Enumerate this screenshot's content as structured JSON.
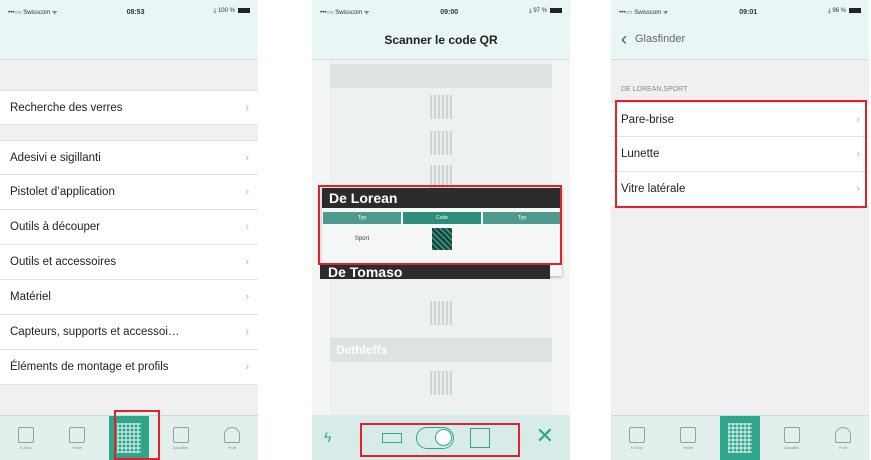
{
  "status": [
    {
      "carrier": "•••○○ Swisscom ᯤ",
      "time": "08:53",
      "right": "⤓ 100 %"
    },
    {
      "carrier": "•••○○ Swisscom ᯤ",
      "time": "09:00",
      "right": "⤓ 97 %"
    },
    {
      "carrier": "•••○○ Swisscom ᯤ",
      "time": "09:01",
      "right": "⤓ 96 %"
    }
  ],
  "screen1": {
    "items_top": [
      {
        "label": "Recherche des verres"
      }
    ],
    "items": [
      {
        "label": "Adesivi e sigillanti"
      },
      {
        "label": "Pistolet d’application"
      },
      {
        "label": "Outils à découper"
      },
      {
        "label": "Outils et accessoires"
      },
      {
        "label": "Matériel"
      },
      {
        "label": "Capteurs, supports et accessoi…"
      },
      {
        "label": "Éléments de montage et profils"
      }
    ],
    "chevron": "›"
  },
  "tabs": [
    {
      "label": "E-Shop",
      "icon": "shop-icon"
    },
    {
      "label": "Panier",
      "icon": "bag-icon"
    },
    {
      "label": "",
      "icon": "qr-code-icon"
    },
    {
      "label": "Actualités",
      "icon": "news-icon"
    },
    {
      "label": "Profil",
      "icon": "profile-icon"
    }
  ],
  "screen2": {
    "title": "Scanner le code QR",
    "popup_brand": "De Lorean",
    "popup_cols": [
      "Typ",
      "Code",
      "Typ"
    ],
    "popup_model": "Sport",
    "next_brand": "De Tomaso",
    "third_brand": "Dethleffs",
    "flash_icon": "ϟ",
    "close_icon": "✕"
  },
  "screen3": {
    "back_label": "Glasfinder",
    "back_icon": "‹",
    "section": "DE LOREAN,SPORT",
    "items": [
      {
        "label": "Pare-brise"
      },
      {
        "label": "Lunette"
      },
      {
        "label": "Vitre latérale"
      }
    ],
    "chevron": "›"
  },
  "colors": {
    "accent": "#2fa68c",
    "highlight": "#e1222b",
    "navbar": "#e8f6f5"
  }
}
